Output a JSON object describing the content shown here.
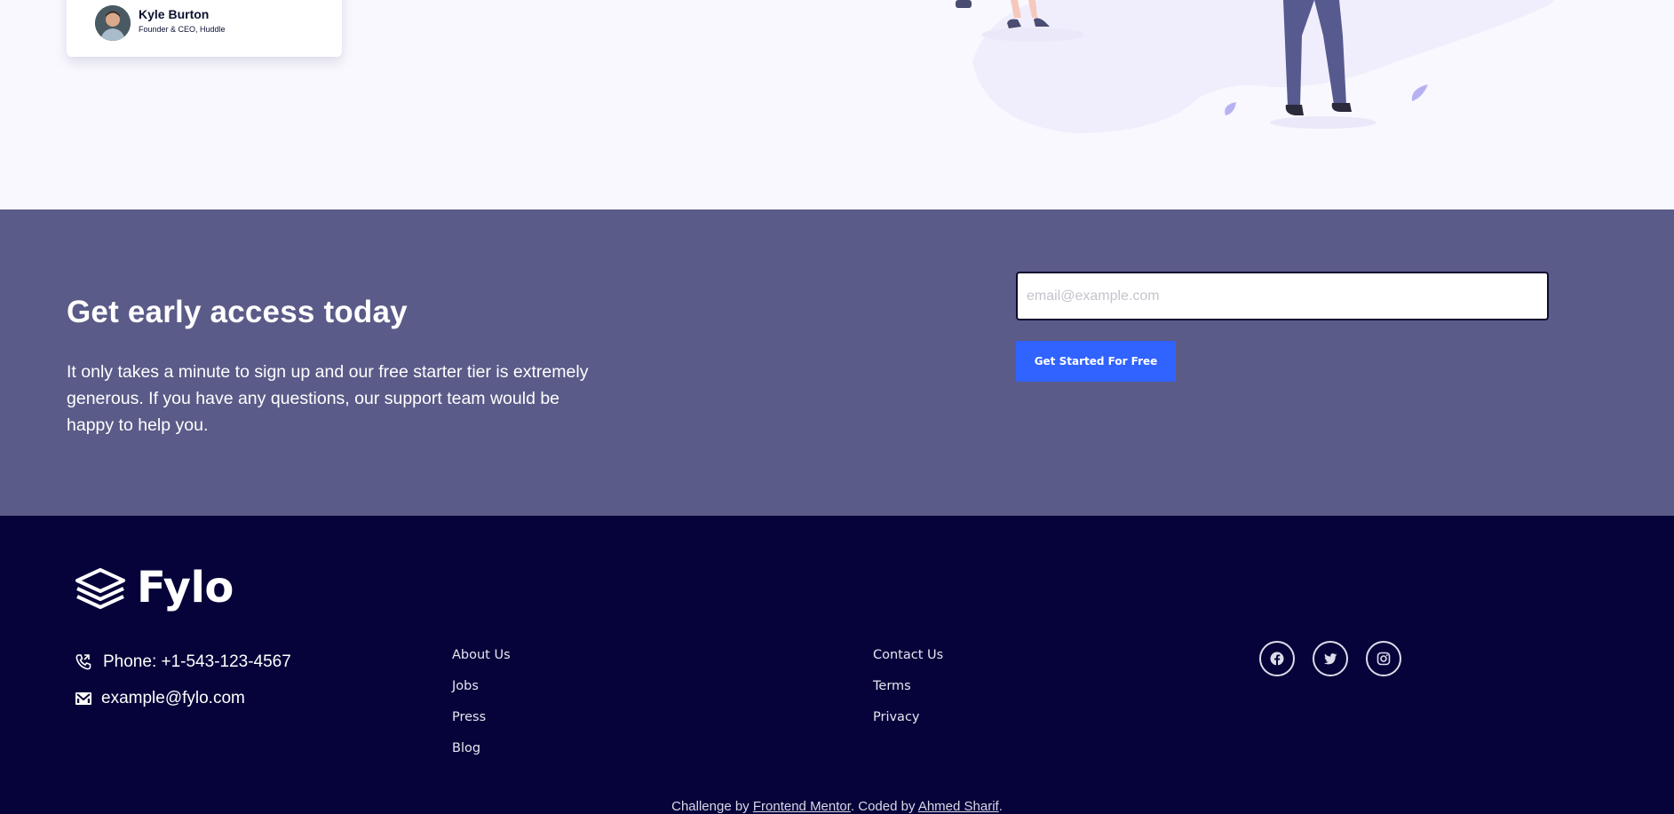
{
  "testimonial": {
    "name": "Kyle Burton",
    "title": "Founder & CEO, Huddle"
  },
  "access": {
    "heading": "Get early access today",
    "body": "It only takes a minute to sign up and our free starter tier is extremely generous. If you have any questions, our support team would be happy to help you.",
    "email_placeholder": "email@example.com",
    "cta_label": "Get Started For Free"
  },
  "footer": {
    "brand": "Fylo",
    "phone": "Phone: +1-543-123-4567",
    "email": "example@fylo.com",
    "links_col1": [
      "About Us",
      "Jobs",
      "Press",
      "Blog"
    ],
    "links_col2": [
      "Contact Us",
      "Terms",
      "Privacy"
    ],
    "socials": [
      "facebook-icon",
      "twitter-icon",
      "instagram-icon"
    ],
    "attribution": {
      "prefix": "Challenge by ",
      "mentor": "Frontend Mentor",
      "middle": ". Coded by ",
      "author": "Ahmed Sharif",
      "suffix": "."
    }
  },
  "colors": {
    "page_bg": "#f9f8ff",
    "access_bg": "#5a5b88",
    "footer_bg": "#06033a",
    "cta": "#3063ff"
  }
}
